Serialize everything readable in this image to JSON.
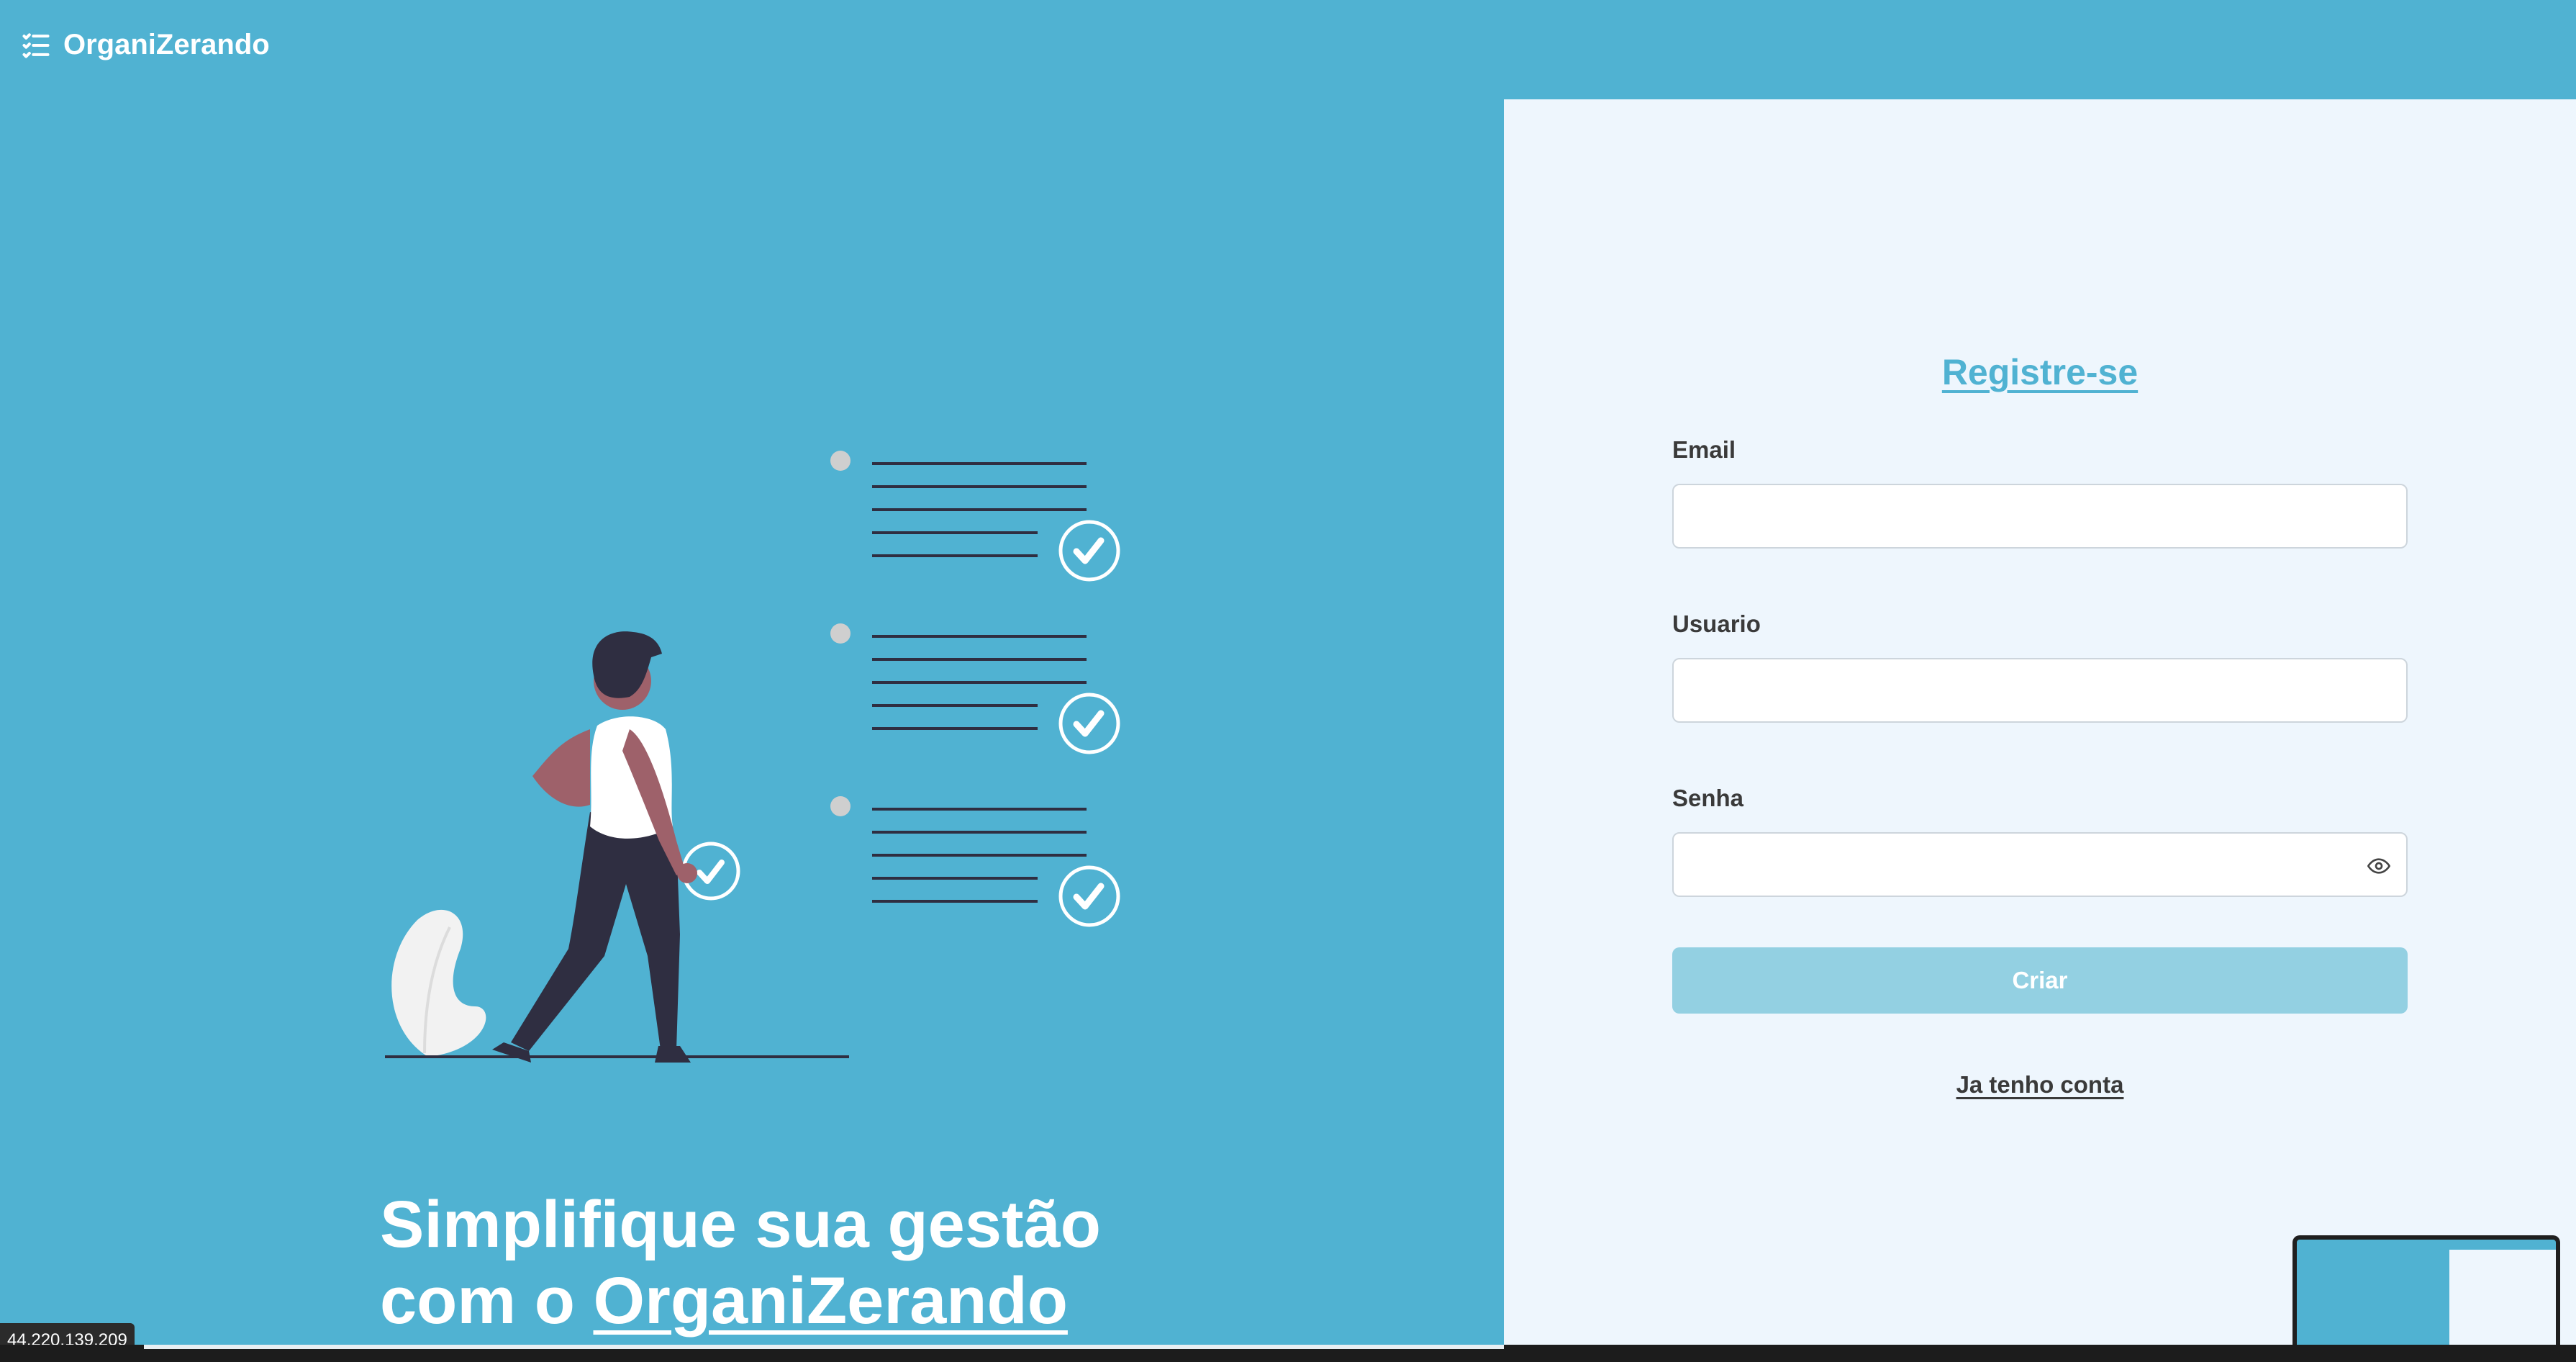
{
  "header": {
    "brand": "OrganiZerando"
  },
  "hero": {
    "line1": "Simplifique sua gestão",
    "line2_prefix": "com o ",
    "line2_brand": "OrganiZerando"
  },
  "form": {
    "title": "Registre-se",
    "email_label": "Email",
    "user_label": "Usuario",
    "password_label": "Senha",
    "submit_label": "Criar",
    "login_link": "Ja tenho conta"
  },
  "status": {
    "ip": "44.220.139.209"
  },
  "colors": {
    "primary": "#50b2d2",
    "panel": "#eef6fd",
    "button_disabled": "#93d0e2",
    "text_dark": "#3a3a3a"
  },
  "icons": {
    "brand": "checklist-icon",
    "password_toggle": "eye-icon"
  }
}
